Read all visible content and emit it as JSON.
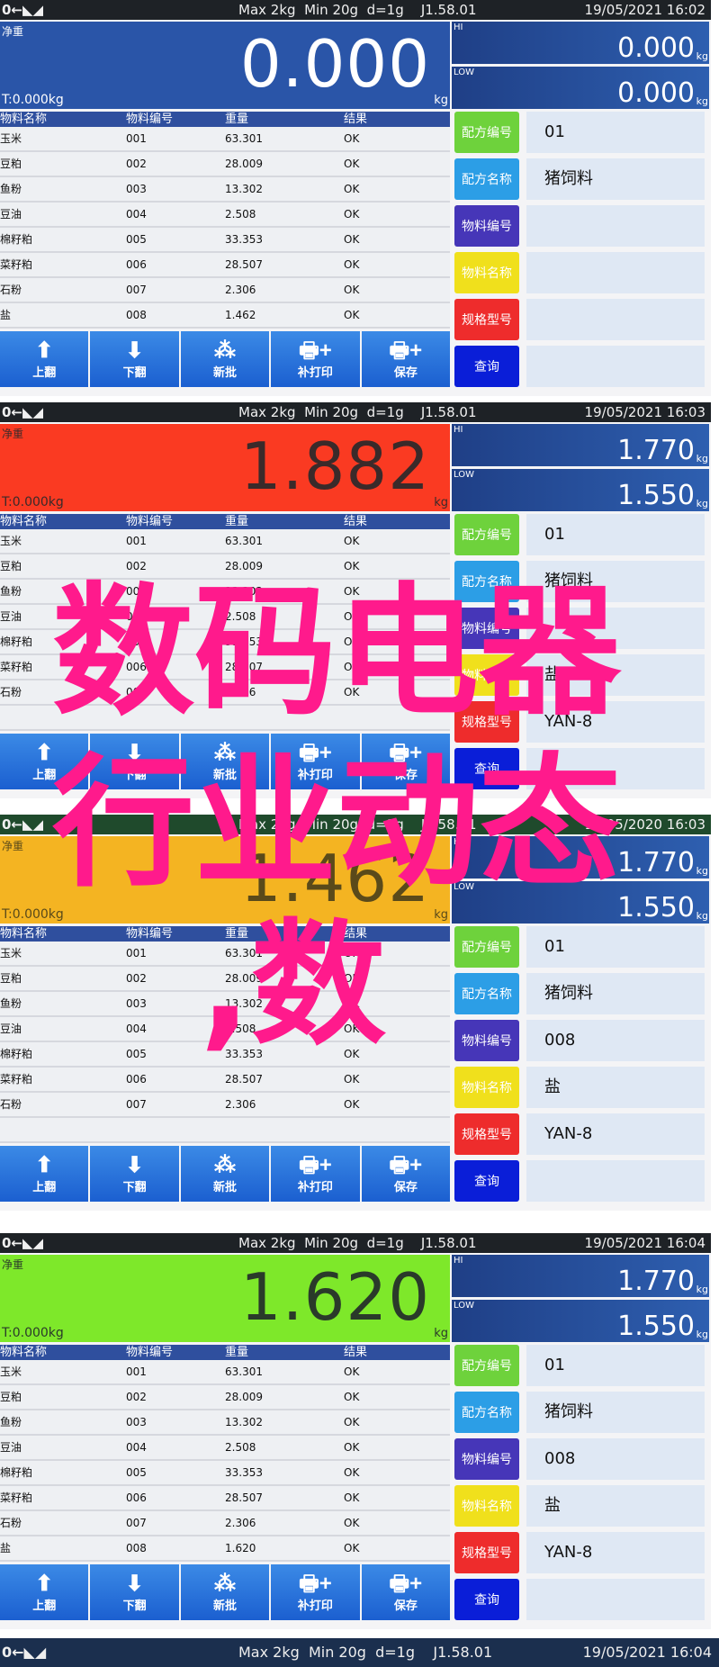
{
  "overlay": {
    "line1": "数码电器",
    "line2": "行业动态",
    "line3": ",数",
    "color": "#ff1a8c"
  },
  "common": {
    "status_icons": "0←◣◢",
    "spec": "Max 2kg  Min 20g  d=1g    J1.58.01",
    "net_label": "净重",
    "tare": "T:0.000kg",
    "unit": "kg",
    "hi_label": "HI",
    "low_label": "LOW",
    "table_headers": [
      "物料名称",
      "物料编号",
      "重量",
      "结果"
    ],
    "toolbar": [
      {
        "icon": "arrow-up-icon",
        "glyph": "⬆",
        "label": "上翻"
      },
      {
        "icon": "arrow-down-icon",
        "glyph": "⬇",
        "label": "下翻"
      },
      {
        "icon": "pyramid-icon",
        "glyph": "⁂",
        "label": "新批"
      },
      {
        "icon": "printer-plus-icon",
        "glyph": "🖶+",
        "label": "补打印"
      },
      {
        "icon": "printer-plus-icon",
        "glyph": "🖶+",
        "label": "保存"
      }
    ],
    "side_buttons": [
      {
        "label": "配方编号",
        "color": "#6ed23c"
      },
      {
        "label": "配方名称",
        "color": "#2c9ee6"
      },
      {
        "label": "物料编号",
        "color": "#4636b8"
      },
      {
        "label": "物料名称",
        "color": "#f0e01c"
      },
      {
        "label": "规格型号",
        "color": "#ee2c2c"
      },
      {
        "label": "查询",
        "color": "#0a1ed8"
      }
    ]
  },
  "panels": [
    {
      "date": "19/05/2021  16:02",
      "weight": "0.000",
      "display_color": "#2a55a8",
      "text_color": "#ffffff",
      "hi": "0.000",
      "low": "0.000",
      "rows": [
        [
          "玉米",
          "001",
          "63.301",
          "OK"
        ],
        [
          "豆粕",
          "002",
          "28.009",
          "OK"
        ],
        [
          "鱼粉",
          "003",
          "13.302",
          "OK"
        ],
        [
          "豆油",
          "004",
          "2.508",
          "OK"
        ],
        [
          "棉籽粕",
          "005",
          "33.353",
          "OK"
        ],
        [
          "菜籽粕",
          "006",
          "28.507",
          "OK"
        ],
        [
          "石粉",
          "007",
          "2.306",
          "OK"
        ],
        [
          "盐",
          "008",
          "1.462",
          "OK"
        ]
      ],
      "side_values": [
        "01",
        "猪饲料",
        "",
        "",
        "",
        ""
      ]
    },
    {
      "date": "19/05/2021  16:03",
      "weight": "1.882",
      "display_color": "#fa3a22",
      "text_color": "#3a2a2a",
      "hi": "1.770",
      "low": "1.550",
      "rows": [
        [
          "玉米",
          "001",
          "63.301",
          "OK"
        ],
        [
          "豆粕",
          "002",
          "28.009",
          "OK"
        ],
        [
          "鱼粉",
          "003",
          "13.302",
          "OK"
        ],
        [
          "豆油",
          "004",
          "2.508",
          "OK"
        ],
        [
          "棉籽粕",
          "005",
          "33.353",
          "OK"
        ],
        [
          "菜籽粕",
          "006",
          "28.507",
          "OK"
        ],
        [
          "石粉",
          "007",
          "2.306",
          "OK"
        ]
      ],
      "side_values": [
        "01",
        "猪饲料",
        "",
        "盐",
        "YAN-8",
        ""
      ]
    },
    {
      "date": "19/05/2020  16:03",
      "weight": "1.462",
      "display_color": "#f4b422",
      "text_color": "#5a4a1a",
      "hi": "1.770",
      "low": "1.550",
      "rows": [
        [
          "玉米",
          "001",
          "63.301",
          "OK"
        ],
        [
          "豆粕",
          "002",
          "28.009",
          "OK"
        ],
        [
          "鱼粉",
          "003",
          "13.302",
          "OK"
        ],
        [
          "豆油",
          "004",
          "2.508",
          "OK"
        ],
        [
          "棉籽粕",
          "005",
          "33.353",
          "OK"
        ],
        [
          "菜籽粕",
          "006",
          "28.507",
          "OK"
        ],
        [
          "石粉",
          "007",
          "2.306",
          "OK"
        ]
      ],
      "side_values": [
        "01",
        "猪饲料",
        "008",
        "盐",
        "YAN-8",
        ""
      ]
    },
    {
      "date": "19/05/2021  16:04",
      "weight": "1.620",
      "display_color": "#7ee82a",
      "text_color": "#2a3a2a",
      "hi": "1.770",
      "low": "1.550",
      "rows": [
        [
          "玉米",
          "001",
          "63.301",
          "OK"
        ],
        [
          "豆粕",
          "002",
          "28.009",
          "OK"
        ],
        [
          "鱼粉",
          "003",
          "13.302",
          "OK"
        ],
        [
          "豆油",
          "004",
          "2.508",
          "OK"
        ],
        [
          "棉籽粕",
          "005",
          "33.353",
          "OK"
        ],
        [
          "菜籽粕",
          "006",
          "28.507",
          "OK"
        ],
        [
          "石粉",
          "007",
          "2.306",
          "OK"
        ],
        [
          "盐",
          "008",
          "1.620",
          "OK"
        ]
      ],
      "side_values": [
        "01",
        "猪饲料",
        "008",
        "盐",
        "YAN-8",
        ""
      ]
    }
  ],
  "bottom_bar": {
    "status_icons": "0←◣◢",
    "spec": "Max 2kg  Min 20g  d=1g    J1.58.01",
    "date": "19/05/2021  16:04"
  }
}
